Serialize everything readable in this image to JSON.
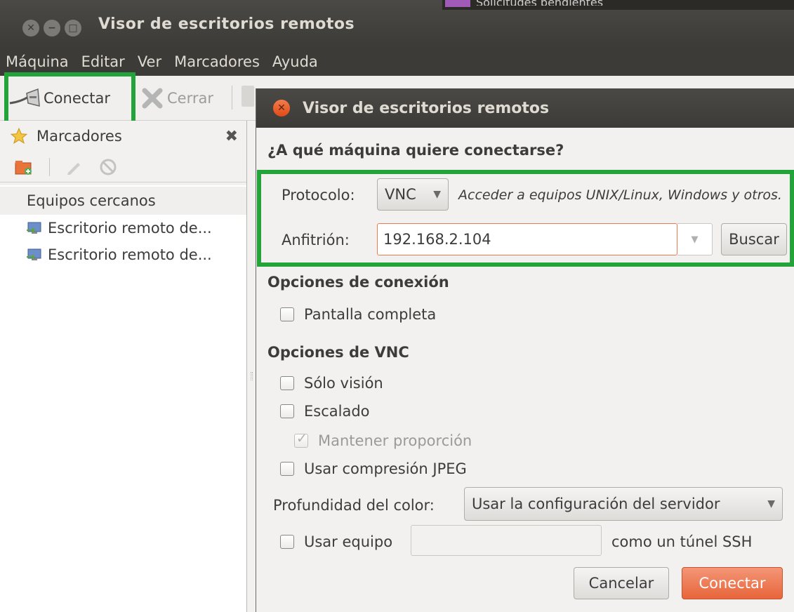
{
  "window": {
    "title": "Visor de escritorios remotos",
    "peek_text": "Solicitudes pendientes"
  },
  "menu": [
    "Máquina",
    "Editar",
    "Ver",
    "Marcadores",
    "Ayuda"
  ],
  "toolbar": {
    "connect_label": "Conectar",
    "close_label": "Cerrar"
  },
  "sidebar": {
    "title": "Marcadores",
    "group": "Equipos cercanos",
    "items": [
      "Escritorio remoto de...",
      "Escritorio remoto de..."
    ]
  },
  "dialog": {
    "title": "Visor de escritorios remotos",
    "question": "¿A qué máquina quiere conectarse?",
    "protocol_label": "Protocolo:",
    "protocol_value": "VNC",
    "protocol_hint": "Acceder a equipos UNIX/Linux, Windows y otros.",
    "host_label": "Anfitrión:",
    "host_value": "192.168.2.104",
    "search_button": "Buscar",
    "connection_options_title": "Opciones de conexión",
    "fullscreen_label": "Pantalla completa",
    "vnc_options_title": "Opciones de VNC",
    "view_only_label": "Sólo visión",
    "scaling_label": "Escalado",
    "keep_ratio_label": "Mantener proporción",
    "jpeg_label": "Usar compresión JPEG",
    "color_depth_label": "Profundidad del color:",
    "color_depth_value": "Usar la configuración del servidor",
    "ssh_prefix_label": "Usar equipo",
    "ssh_suffix_label": "como un túnel SSH",
    "cancel_button": "Cancelar",
    "connect_button": "Conectar"
  },
  "colors": {
    "highlight": "#22a43a",
    "accent": "#e8653a",
    "titlebar": "#3c3b37"
  }
}
